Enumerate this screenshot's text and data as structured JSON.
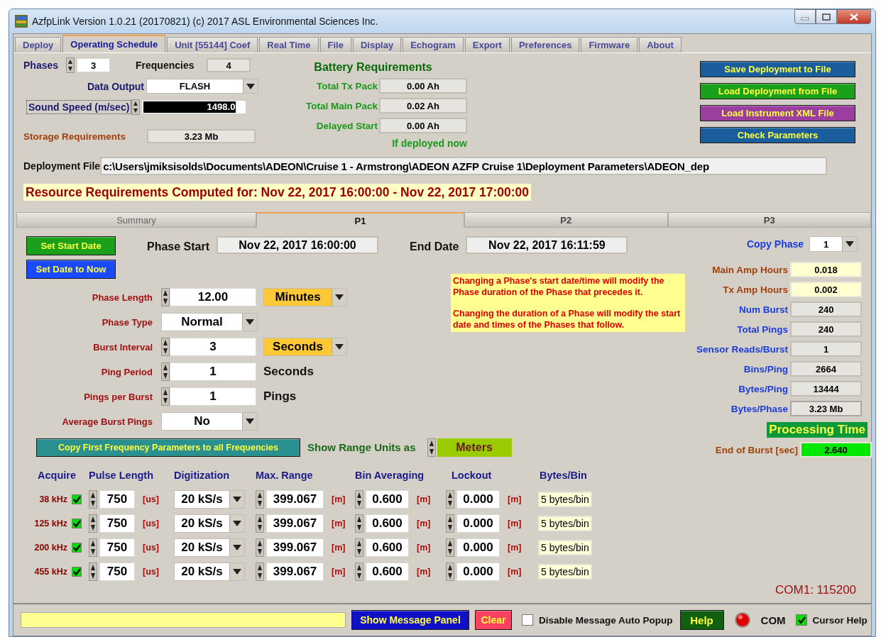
{
  "window": {
    "title": "AzfpLink Version 1.0.21 (20170821) (c) 2017 ASL Environmental Sciences Inc."
  },
  "tabs": [
    {
      "label": "Deploy",
      "selected": false
    },
    {
      "label": "Operating Schedule",
      "selected": true
    },
    {
      "label": "Unit [55144] Coef",
      "selected": false
    },
    {
      "label": "Real Time",
      "selected": false
    },
    {
      "label": "File",
      "selected": false
    },
    {
      "label": "Display",
      "selected": false
    },
    {
      "label": "Echogram",
      "selected": false
    },
    {
      "label": "Export",
      "selected": false
    },
    {
      "label": "Preferences",
      "selected": false
    },
    {
      "label": "Firmware",
      "selected": false
    },
    {
      "label": "About",
      "selected": false
    }
  ],
  "settings": {
    "phases": {
      "label": "Phases",
      "value": "3"
    },
    "frequencies": {
      "label": "Frequencies",
      "value": "4"
    },
    "data_output": {
      "label": "Data Output",
      "value": "FLASH"
    },
    "sound_speed": {
      "label": "Sound Speed (m/sec)",
      "value": "1498.0"
    },
    "storage": {
      "label": "Storage Requirements",
      "value": "3.23 Mb"
    }
  },
  "battery": {
    "title": "Battery Requirements",
    "rows": [
      {
        "label": "Total Tx Pack",
        "value": "0.00 Ah"
      },
      {
        "label": "Total Main Pack",
        "value": "0.02 Ah"
      },
      {
        "label": "Delayed Start",
        "value": "0.00 Ah"
      }
    ],
    "note": "If deployed now"
  },
  "file_buttons": [
    {
      "label": "Save Deployment to File",
      "color": "#1b5e9e"
    },
    {
      "label": "Load Deployment from File",
      "color": "#1aa01a"
    },
    {
      "label": "Load Instrument XML File",
      "color": "#9b3ea0"
    },
    {
      "label": "Check Parameters",
      "color": "#1b5e9e"
    }
  ],
  "deployment_file": {
    "label": "Deployment File",
    "value": "c:\\Users\\jmiksisolds\\Documents\\ADEON\\Cruise 1 - Armstrong\\ADEON AZFP Cruise 1\\Deployment Parameters\\ADEON_dep"
  },
  "resource_banner": "Resource Requirements Computed for:  Nov 22, 2017 16:00:00 - Nov 22, 2017 17:00:00",
  "phase_tabs": [
    {
      "label": "Summary",
      "selected": false
    },
    {
      "label": "P1",
      "selected": true
    },
    {
      "label": "P2",
      "selected": false
    },
    {
      "label": "P3",
      "selected": false
    }
  ],
  "phase": {
    "buttons": [
      {
        "label": "Set Start Date",
        "color": "#1aa01a"
      },
      {
        "label": "Set Date to Now",
        "color": "#1a4aff"
      }
    ],
    "start": {
      "label": "Phase Start",
      "value": "Nov 22, 2017 16:00:00"
    },
    "end": {
      "label": "End Date",
      "value": "Nov 22, 2017 16:11:59"
    },
    "copy_phase": {
      "label": "Copy Phase",
      "value": "1"
    },
    "params": [
      {
        "kind": "spin",
        "label": "Phase Length",
        "value": "12.00",
        "unit": {
          "kind": "dropdown",
          "value": "Minutes"
        }
      },
      {
        "kind": "dropdown",
        "label": "Phase Type",
        "value": "Normal"
      },
      {
        "kind": "spin",
        "label": "Burst Interval",
        "value": "3",
        "unit": {
          "kind": "dropdown",
          "value": "Seconds"
        }
      },
      {
        "kind": "spin",
        "label": "Ping Period",
        "value": "1",
        "unit": {
          "kind": "text",
          "value": "Seconds"
        }
      },
      {
        "kind": "spin",
        "label": "Pings per Burst",
        "value": "1",
        "unit": {
          "kind": "text",
          "value": "Pings"
        }
      },
      {
        "kind": "dropdown",
        "label": "Average Burst Pings",
        "value": "No"
      }
    ],
    "note": [
      "Changing a Phase's start date/time will modify the Phase duration of the Phase that precedes it.",
      "Changing the duration of a Phase will modify the start date and times of the Phases that follow."
    ],
    "stats": [
      {
        "kind": "amp",
        "label": "Main Amp Hours",
        "value": "0.018"
      },
      {
        "kind": "amp",
        "label": "Tx Amp Hours",
        "value": "0.002"
      },
      {
        "kind": "count",
        "label": "Num Burst",
        "value": "240"
      },
      {
        "kind": "count",
        "label": "Total Pings",
        "value": "240"
      },
      {
        "kind": "count",
        "label": "Sensor Reads/Burst",
        "value": "1"
      },
      {
        "kind": "count",
        "label": "Bins/Ping",
        "value": "2664"
      },
      {
        "kind": "count",
        "label": "Bytes/Ping",
        "value": "13444"
      },
      {
        "kind": "total",
        "label": "Bytes/Phase",
        "value": "3.23 Mb"
      }
    ],
    "processing": {
      "title": "Processing Time",
      "label": "End of Burst [sec]",
      "value": "2.640"
    },
    "copy_freq_button": "Copy First Frequency Parameters to all Frequencies",
    "range_units": {
      "label": "Show Range Units as",
      "value": "Meters"
    },
    "freq_table": {
      "columns": [
        "Acquire",
        "Pulse Length",
        "Digitization",
        "Max. Range",
        "Bin Averaging",
        "Lockout",
        "Bytes/Bin"
      ],
      "rows": [
        {
          "freq": "38 kHz",
          "acquire": true,
          "pulse": "750",
          "pulse_unit": "[us]",
          "digitization": "20 kS/s",
          "max_range": "399.067",
          "range_unit": "[m]",
          "bin_avg": "0.600",
          "bin_unit": "[m]",
          "lockout": "0.000",
          "lockout_unit": "[m]",
          "bytes_bin": "5 bytes/bin"
        },
        {
          "freq": "125 kHz",
          "acquire": true,
          "pulse": "750",
          "pulse_unit": "[us]",
          "digitization": "20 kS/s",
          "max_range": "399.067",
          "range_unit": "[m]",
          "bin_avg": "0.600",
          "bin_unit": "[m]",
          "lockout": "0.000",
          "lockout_unit": "[m]",
          "bytes_bin": "5 bytes/bin"
        },
        {
          "freq": "200 kHz",
          "acquire": true,
          "pulse": "750",
          "pulse_unit": "[us]",
          "digitization": "20 kS/s",
          "max_range": "399.067",
          "range_unit": "[m]",
          "bin_avg": "0.600",
          "bin_unit": "[m]",
          "lockout": "0.000",
          "lockout_unit": "[m]",
          "bytes_bin": "5 bytes/bin"
        },
        {
          "freq": "455 kHz",
          "acquire": true,
          "pulse": "750",
          "pulse_unit": "[us]",
          "digitization": "20 kS/s",
          "max_range": "399.067",
          "range_unit": "[m]",
          "bin_avg": "0.600",
          "bin_unit": "[m]",
          "lockout": "0.000",
          "lockout_unit": "[m]",
          "bytes_bin": "5 bytes/bin"
        }
      ]
    }
  },
  "com_status": "COM1: 115200",
  "bottom_bar": {
    "show_panel": "Show Message Panel",
    "clear": "Clear",
    "disable_popup": {
      "label": "Disable Message Auto Popup",
      "checked": false
    },
    "help": "Help",
    "com": "COM",
    "cursor_help": {
      "label": "Cursor Help",
      "checked": true
    }
  }
}
